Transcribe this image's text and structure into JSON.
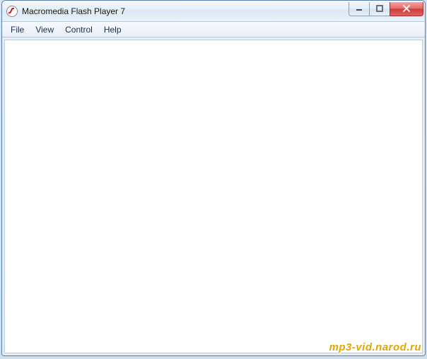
{
  "titlebar": {
    "title": "Macromedia Flash Player 7"
  },
  "menubar": {
    "items": [
      "File",
      "View",
      "Control",
      "Help"
    ]
  },
  "watermark": "mp3-vid.narod.ru"
}
